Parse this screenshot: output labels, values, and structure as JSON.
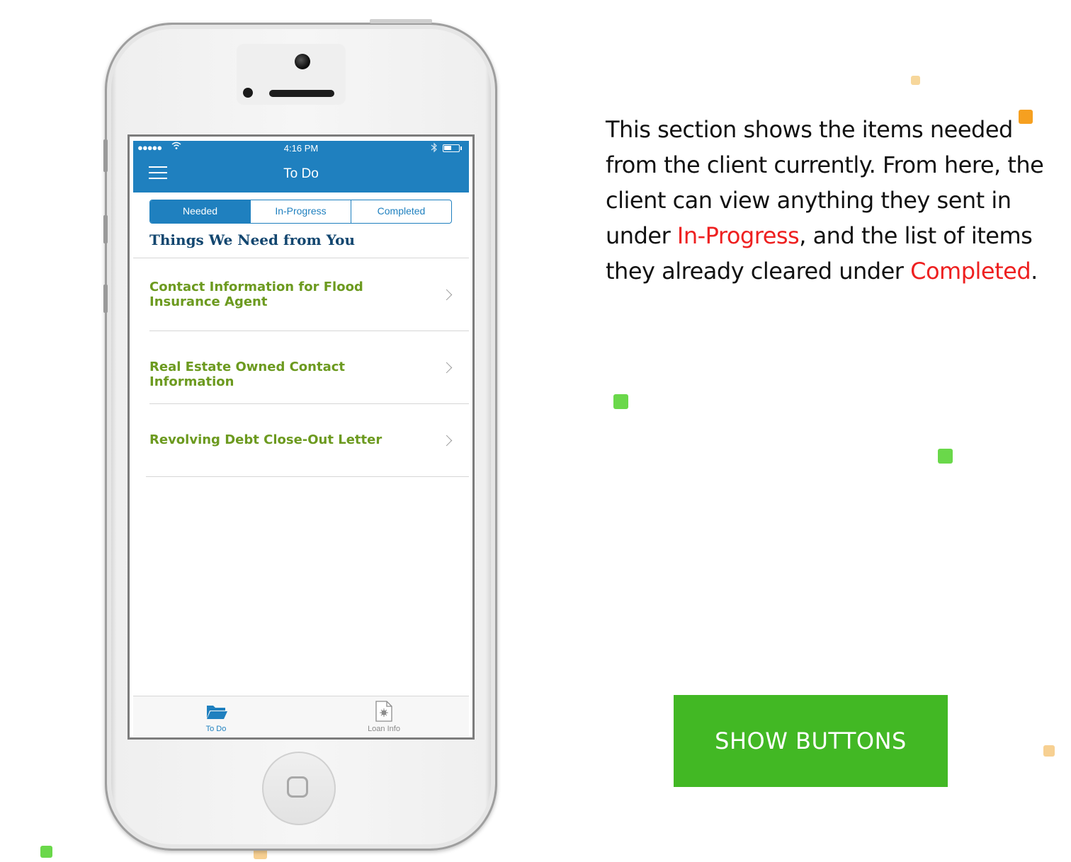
{
  "status_bar": {
    "signal": "●●●●●",
    "time": "4:16 PM"
  },
  "nav": {
    "title": "To Do"
  },
  "segments": [
    {
      "label": "Needed",
      "active": true
    },
    {
      "label": "In-Progress",
      "active": false
    },
    {
      "label": "Completed",
      "active": false
    }
  ],
  "section_title": "Things We Need from You",
  "items": [
    {
      "label": "Contact Information for Flood Insurance Agent"
    },
    {
      "label": "Real Estate Owned Contact Information"
    },
    {
      "label": "Revolving Debt Close-Out Letter"
    }
  ],
  "tabs": [
    {
      "label": "To Do",
      "icon": "folder-icon",
      "active": true
    },
    {
      "label": "Loan Info",
      "icon": "document-icon",
      "active": false
    }
  ],
  "description": {
    "part1": "This section shows the items needed from the client currently.   From here, the client can view anything they sent in under ",
    "highlight1": "In-Progress",
    "part2": ", and the list of items they already cleared under ",
    "highlight2": "Completed",
    "part3": "."
  },
  "show_buttons_label": "SHOW BUTTONS",
  "colors": {
    "nav_blue": "#1f80bf",
    "title_navy": "#12466f",
    "item_green": "#6c9a1f",
    "button_green": "#42b824",
    "highlight_red": "#ee2020"
  }
}
